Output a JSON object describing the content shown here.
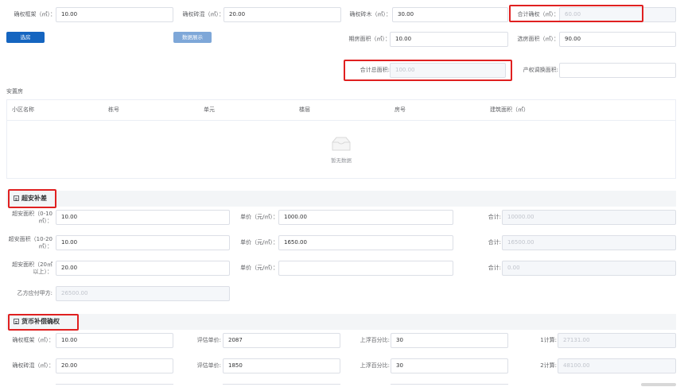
{
  "top": {
    "row1": [
      {
        "label": "确权框架（㎡）：",
        "value": "10.00"
      },
      {
        "label": "确权砖混（㎡）：",
        "value": "20.00"
      },
      {
        "label": "确权砖木（㎡）：",
        "value": "30.00"
      },
      {
        "label": "合计确权（㎡）：",
        "value": "60.00"
      }
    ],
    "select_button": "选房",
    "data_show_button": "数据展示",
    "row2": [
      {
        "label": "期房面积（㎡）：",
        "value": "10.00"
      },
      {
        "label": "选房面积（㎡）：",
        "value": "90.00"
      }
    ],
    "total_area_label": "合计总面积:",
    "total_area_value": "100.00",
    "exchange_label": "产权调换面积:",
    "exchange_value": ""
  },
  "resettle": {
    "title": "安置房",
    "columns": [
      "小区名称",
      "栋号",
      "单元",
      "楼层",
      "房号",
      "建筑面积（㎡）"
    ],
    "empty_text": "暂无数据"
  },
  "excess": {
    "title": "超安补差",
    "rows": [
      {
        "label_line1": "超安面积（0-10",
        "label_line2": "㎡）：",
        "area": "10.00",
        "price_label": "单价（元/㎡）：",
        "price": "1000.00",
        "total_label": "合计:",
        "total": "10000.00"
      },
      {
        "label_line1": "超安面积（10-20",
        "label_line2": "㎡）：",
        "area": "10.00",
        "price_label": "单价（元/㎡）：",
        "price": "1650.00",
        "total_label": "合计:",
        "total": "16500.00"
      },
      {
        "label_line1": "超安面积（20㎡",
        "label_line2": "以上）：",
        "area": "20.00",
        "price_label": "单价（元/㎡）：",
        "price": "",
        "total_label": "合计:",
        "total": "0.00"
      }
    ],
    "payable_label": "乙方应付甲方:",
    "payable_value": "26500.00"
  },
  "monetary": {
    "title": "货币补偿确权",
    "rows": [
      {
        "label": "确权框架（㎡）：",
        "area": "10.00",
        "price_label": "评估单价:",
        "price": "2087",
        "pct_label": "上浮百分比:",
        "pct": "30",
        "calc_label": "1计算:",
        "calc": "27131.00"
      },
      {
        "label": "确权砖混（㎡）：",
        "area": "20.00",
        "price_label": "评估单价:",
        "price": "1850",
        "pct_label": "上浮百分比:",
        "pct": "30",
        "calc_label": "2计算:",
        "calc": "48100.00"
      }
    ]
  },
  "colors": {
    "primary": "#1565c0",
    "info": "#7ea7d8",
    "highlight": "#e02020"
  }
}
